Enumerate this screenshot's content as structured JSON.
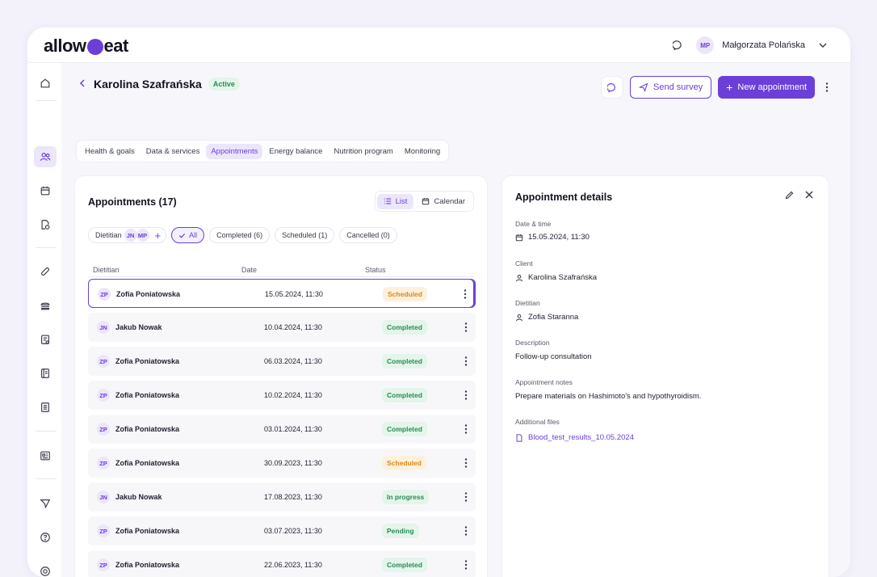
{
  "app": {
    "brand_left": "allow",
    "brand_right": "eat"
  },
  "user": {
    "initials": "MP",
    "name": "Małgorzata Polańska"
  },
  "client": {
    "name": "Karolina Szafrańska",
    "status": "Active"
  },
  "actions": {
    "send_survey": "Send survey",
    "new_appointment": "New appointment"
  },
  "tabs": [
    {
      "label": "Health & goals"
    },
    {
      "label": "Data & services"
    },
    {
      "label": "Appointments"
    },
    {
      "label": "Energy balance"
    },
    {
      "label": "Nutrition program"
    },
    {
      "label": "Monitoring"
    }
  ],
  "appointments": {
    "title": "Appointments (17)",
    "view_list": "List",
    "view_calendar": "Calendar",
    "filters": {
      "dietitian_label": "Dietitian",
      "dietitian_avatars": [
        "JN",
        "MP"
      ],
      "all": "All",
      "completed": "Completed (6)",
      "scheduled": "Scheduled (1)",
      "cancelled": "Cancelled (0)"
    },
    "columns": {
      "dietitian": "Dietitian",
      "date": "Date",
      "status": "Status"
    },
    "rows": [
      {
        "initials": "ZP",
        "name": "Zofia Poniatowska",
        "date": "15.05.2024, 11:30",
        "status": "Scheduled"
      },
      {
        "initials": "JN",
        "name": "Jakub Nowak",
        "date": "10.04.2024, 11:30",
        "status": "Completed"
      },
      {
        "initials": "ZP",
        "name": "Zofia Poniatowska",
        "date": "06.03.2024, 11:30",
        "status": "Completed"
      },
      {
        "initials": "ZP",
        "name": "Zofia Poniatowska",
        "date": "10.02.2024, 11:30",
        "status": "Completed"
      },
      {
        "initials": "ZP",
        "name": "Zofia Poniatowska",
        "date": "03.01.2024, 11:30",
        "status": "Completed"
      },
      {
        "initials": "ZP",
        "name": "Zofia Poniatowska",
        "date": "30.09.2023, 11:30",
        "status": "Scheduled"
      },
      {
        "initials": "JN",
        "name": "Jakub Nowak",
        "date": "17.08.2023, 11:30",
        "status": "In progress"
      },
      {
        "initials": "ZP",
        "name": "Zofia Poniatowska",
        "date": "03.07.2023, 11:30",
        "status": "Pending"
      },
      {
        "initials": "ZP",
        "name": "Zofia Poniatowska",
        "date": "22.06.2023, 11:30",
        "status": "Completed"
      }
    ]
  },
  "status_colors": {
    "Scheduled": {
      "fg": "#d98a1c",
      "bg": "#fdf1dc"
    },
    "Completed": {
      "fg": "#2a8a5a",
      "bg": "#e4f5ea"
    },
    "In progress": {
      "fg": "#2a8a5a",
      "bg": "#e4f5ea"
    },
    "Pending": {
      "fg": "#2a8a5a",
      "bg": "#e4f5ea"
    }
  },
  "details": {
    "title": "Appointment details",
    "date_label": "Date & time",
    "date_value": "15.05.2024, 11:30",
    "client_label": "Client",
    "client_value": "Karolina Szafrańska",
    "dietitian_label": "Dietitian",
    "dietitian_value": "Zofia Staranna",
    "description_label": "Description",
    "description_value": "Follow-up consultation",
    "notes_label": "Appointment notes",
    "notes_value": "Prepare materials on Hashimoto's and hypothyroidism.",
    "files_label": "Additional files",
    "file_name": "Blood_test_results_10.05.2024"
  },
  "colors": {
    "accent": "#6b3fd8",
    "accent_soft": "#ece6fb"
  }
}
